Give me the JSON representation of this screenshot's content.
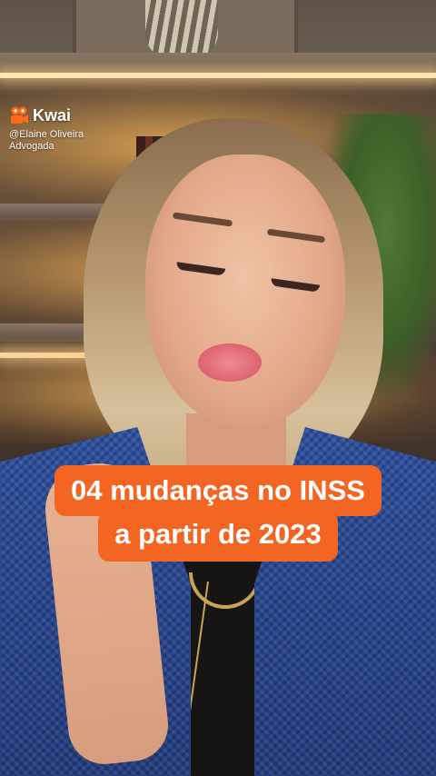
{
  "watermark": {
    "app_name": "Kwai",
    "handle": "@Elaine Oliveira",
    "role": "Advogada",
    "icon": "kwai-logo-icon",
    "brand_color": "#ff6a1a"
  },
  "caption": {
    "line1": "04 mudanças no INSS",
    "line2": "a partir de 2023",
    "background_color": "#f26522",
    "text_color": "#ffffff"
  }
}
